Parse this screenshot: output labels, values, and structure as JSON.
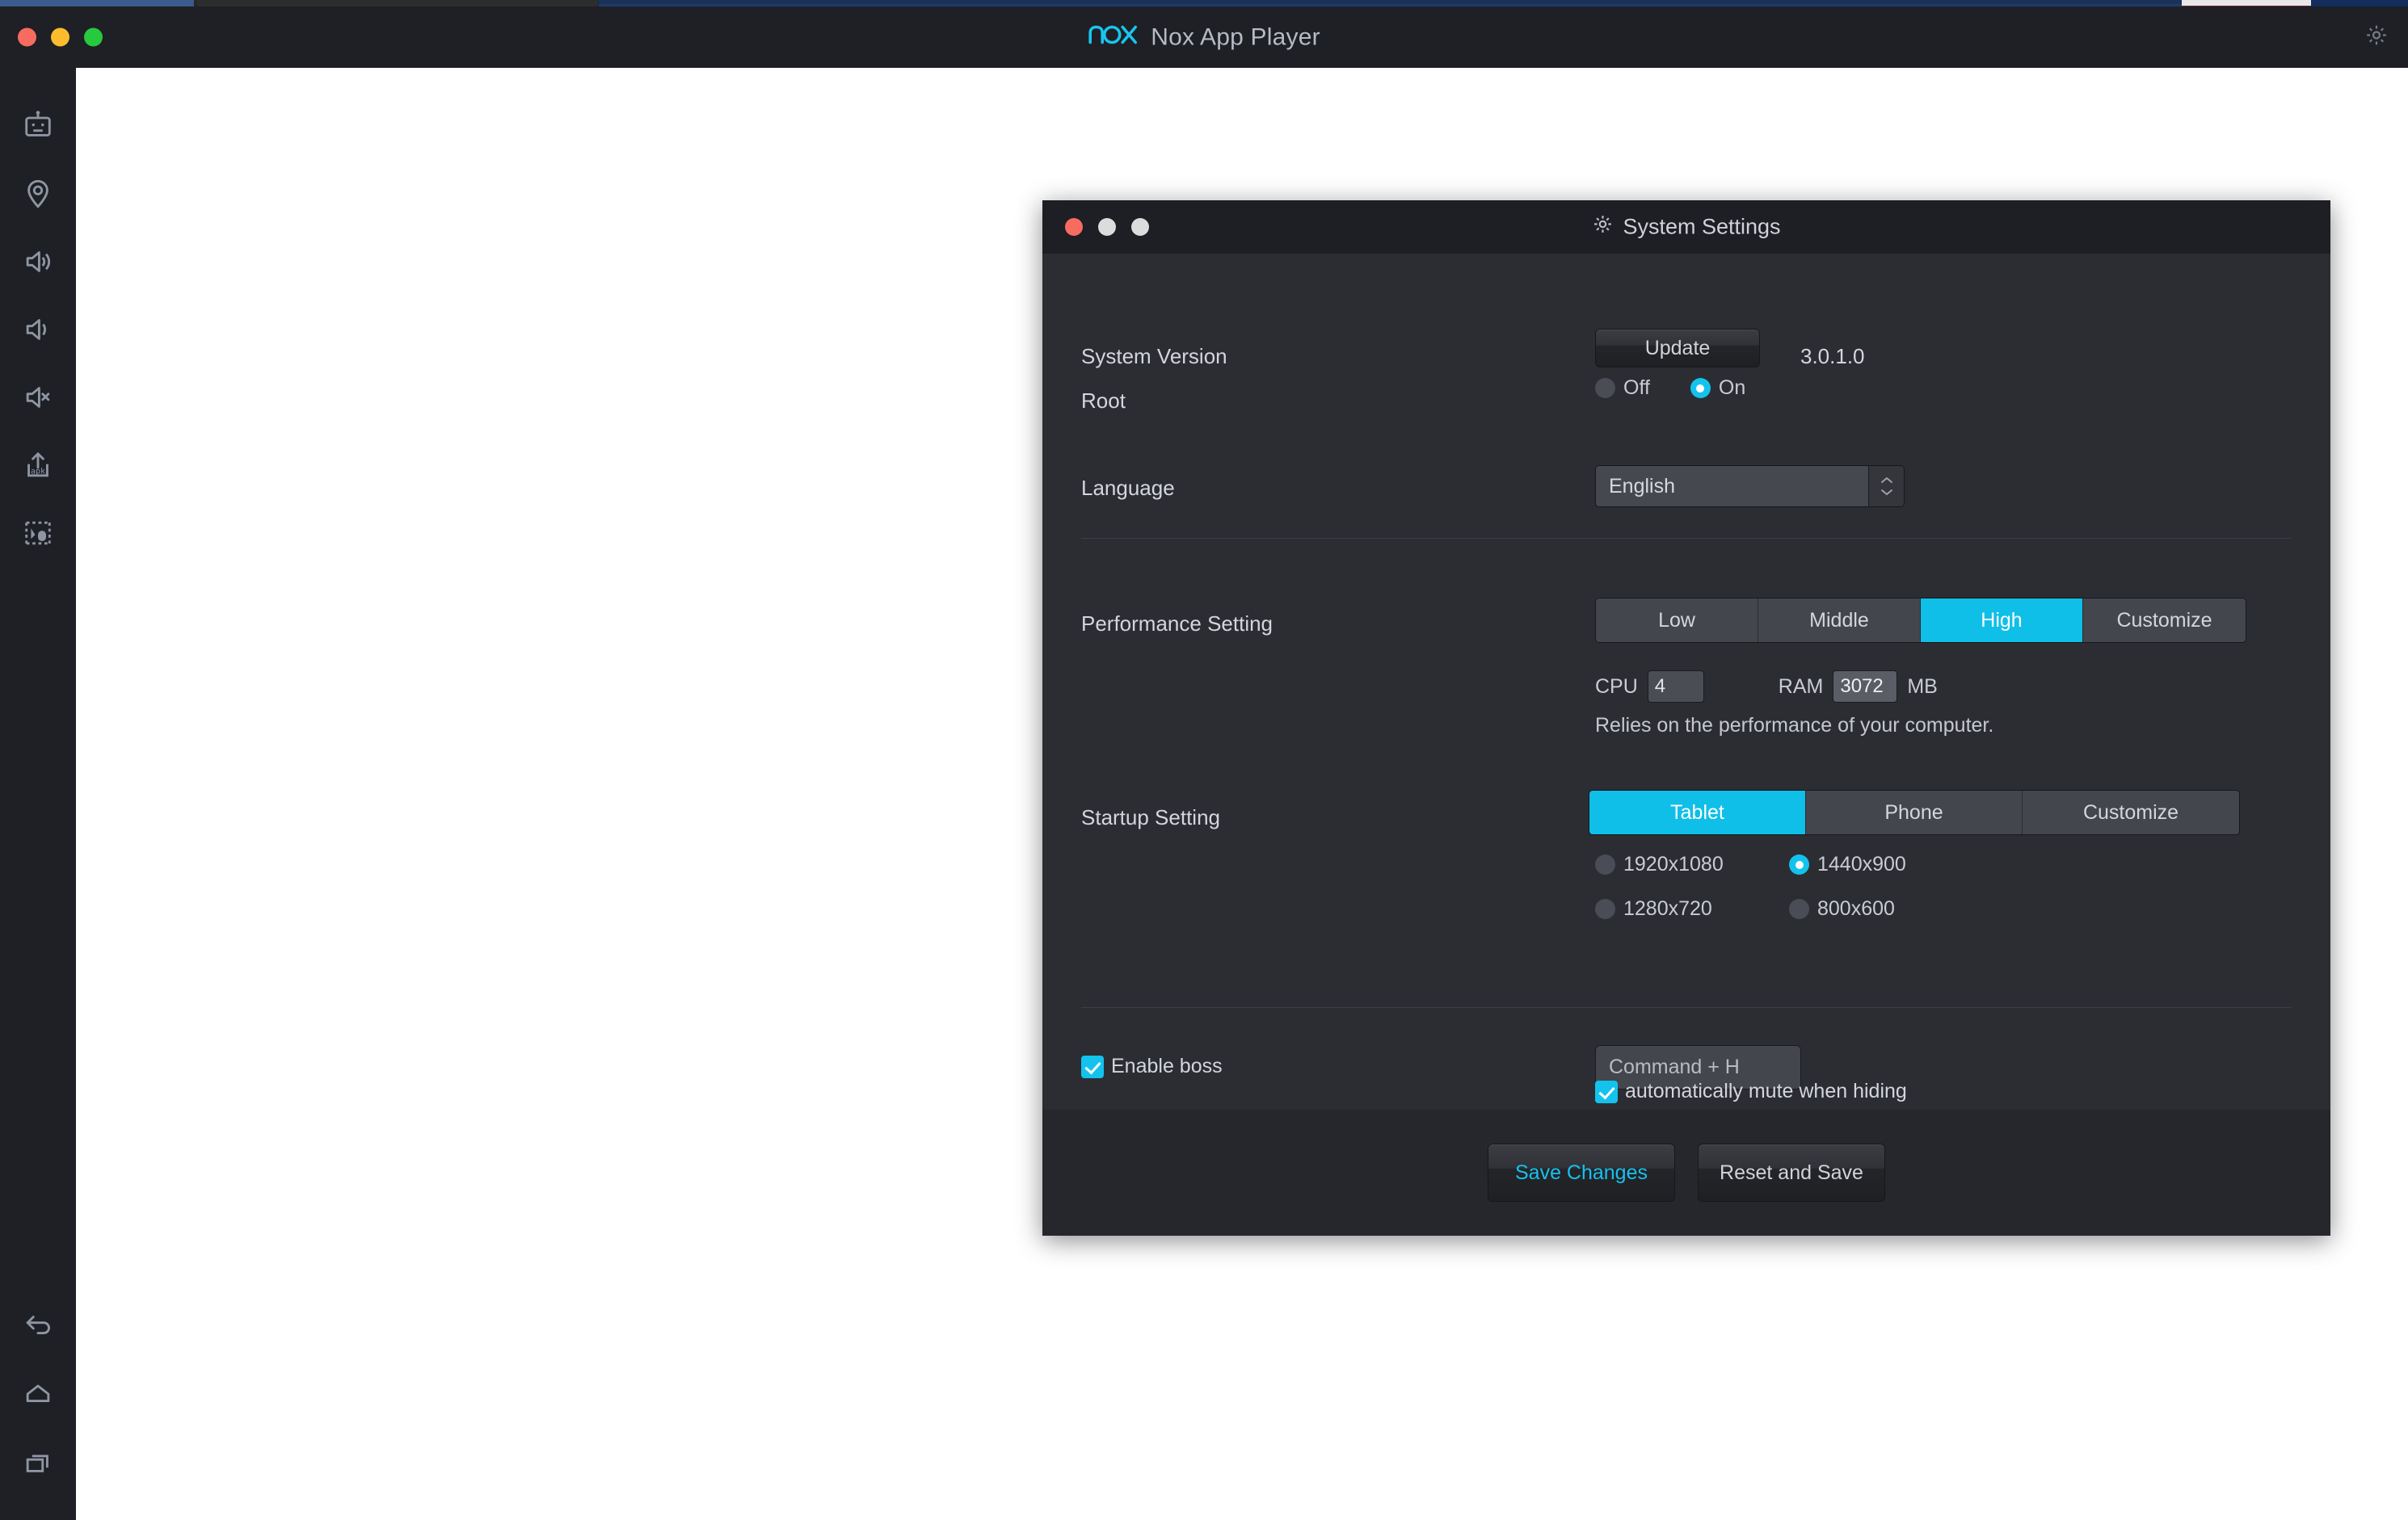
{
  "window": {
    "title": "Nox App Player",
    "logo_text": "nox",
    "traffic_lights": [
      "close-button",
      "minimize-button",
      "maximize-button"
    ],
    "settings_icon": "gear-icon"
  },
  "sidebar": {
    "top_items": [
      {
        "name": "android-robot-icon",
        "tooltip": "Android"
      },
      {
        "name": "location-pin-icon",
        "tooltip": "Location"
      },
      {
        "name": "volume-up-icon",
        "tooltip": "Volume Up"
      },
      {
        "name": "volume-down-icon",
        "tooltip": "Volume Down"
      },
      {
        "name": "volume-mute-icon",
        "tooltip": "Mute"
      },
      {
        "name": "apk-install-icon",
        "tooltip": "Install APK"
      },
      {
        "name": "keyboard-mapping-icon",
        "tooltip": "Key Mapping"
      }
    ],
    "bottom_items": [
      {
        "name": "back-icon",
        "tooltip": "Back"
      },
      {
        "name": "home-icon",
        "tooltip": "Home"
      },
      {
        "name": "recents-icon",
        "tooltip": "Recents"
      }
    ]
  },
  "dialog": {
    "title": "System Settings",
    "title_icon": "gear-icon",
    "traffic_lights": [
      "close-button",
      "minimize-button",
      "maximize-button"
    ],
    "system_version": {
      "label": "System Version",
      "update_button": "Update",
      "version": "3.0.1.0"
    },
    "root": {
      "label": "Root",
      "options": [
        {
          "label": "Off",
          "selected": false
        },
        {
          "label": "On",
          "selected": true
        }
      ]
    },
    "language": {
      "label": "Language",
      "value": "English"
    },
    "performance": {
      "label": "Performance Setting",
      "options": [
        {
          "label": "Low",
          "active": false
        },
        {
          "label": "Middle",
          "active": false
        },
        {
          "label": "High",
          "active": true
        },
        {
          "label": "Customize",
          "active": false
        }
      ],
      "cpu_label": "CPU",
      "cpu_value": "4",
      "ram_label": "RAM",
      "ram_value": "3072",
      "ram_unit": "MB",
      "hint": "Relies on the performance of your computer."
    },
    "startup": {
      "label": "Startup Setting",
      "options": [
        {
          "label": "Tablet",
          "active": true
        },
        {
          "label": "Phone",
          "active": false
        },
        {
          "label": "Customize",
          "active": false
        }
      ],
      "resolutions": [
        {
          "label": "1920x1080",
          "selected": false
        },
        {
          "label": "1440x900",
          "selected": true
        },
        {
          "label": "1280x720",
          "selected": false
        },
        {
          "label": "800x600",
          "selected": false
        }
      ]
    },
    "boss": {
      "enable_label": "Enable boss",
      "enable_checked": true,
      "hotkey_value": "Command + H",
      "mute_label": "automatically mute when hiding",
      "mute_checked": true
    },
    "footer": {
      "save_label": "Save Changes",
      "reset_label": "Reset and Save"
    }
  },
  "colors": {
    "accent": "#0fbfe8",
    "accent_text": "#18c0ec",
    "dialog_bg": "#2b2d33",
    "titlebar_bg": "#1e2025",
    "footer_bg": "#25272c"
  }
}
